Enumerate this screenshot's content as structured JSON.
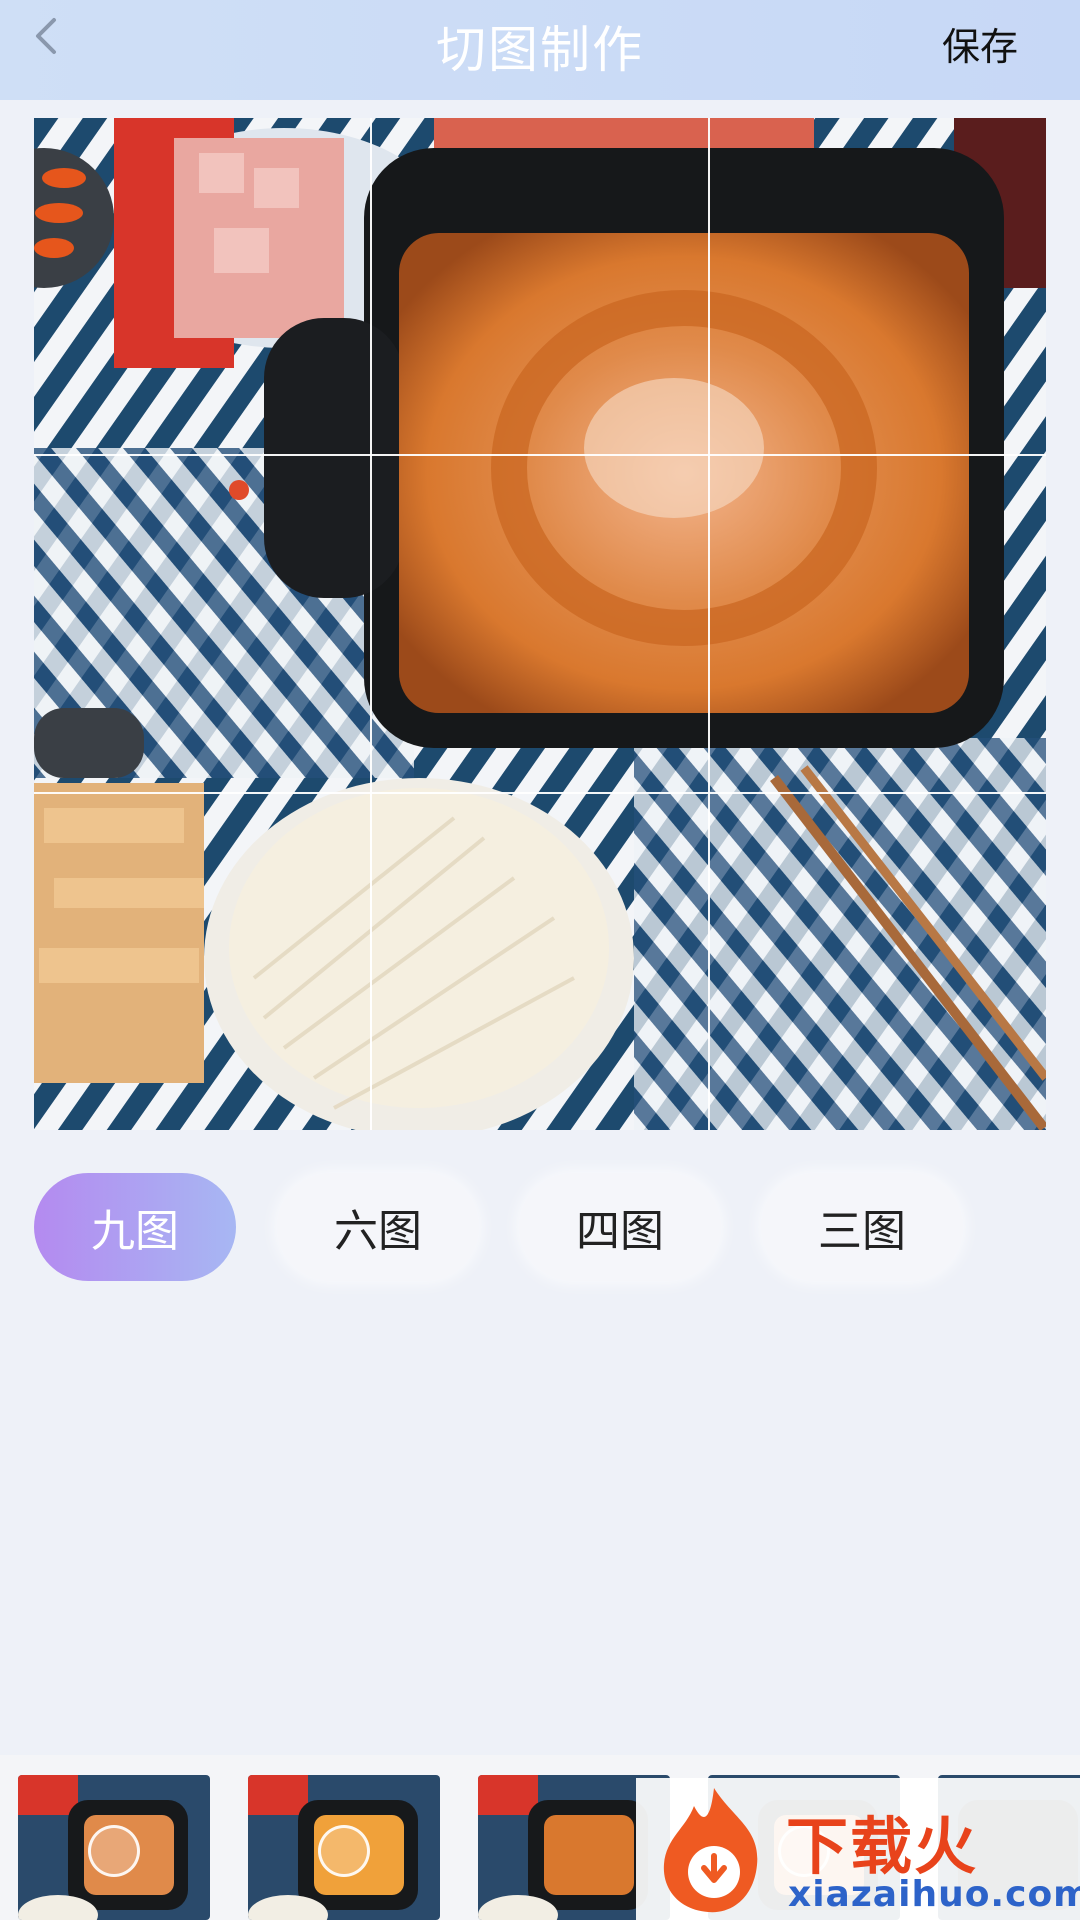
{
  "header": {
    "title": "切图制作",
    "save_label": "保存",
    "back_icon": "chevron-left-icon"
  },
  "preview": {
    "grid": "3x3",
    "image_subject": "hotpot"
  },
  "tabs": [
    {
      "label": "九图",
      "active": true
    },
    {
      "label": "六图",
      "active": false
    },
    {
      "label": "四图",
      "active": false
    },
    {
      "label": "三图",
      "active": false
    }
  ],
  "thumbnails": [
    {
      "selected": true
    },
    {
      "selected": true
    },
    {
      "selected": false
    },
    {
      "selected": true
    },
    {
      "selected": false
    }
  ],
  "watermark": {
    "brand": "下载火",
    "url": "xiazaihuo.com"
  },
  "colors": {
    "header_bg": "#c9daf6",
    "tab_active_start": "#b48af0",
    "tab_active_end": "#a7b7f3",
    "page_bg": "#eef1f8"
  }
}
